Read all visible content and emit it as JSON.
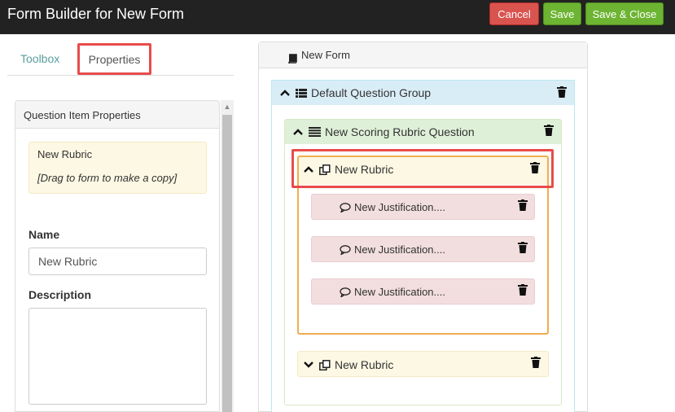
{
  "header": {
    "title": "Form Builder for New Form",
    "cancel_label": "Cancel",
    "save_label": "Save",
    "save_close_label": "Save & Close"
  },
  "tabs": {
    "toolbox": "Toolbox",
    "properties": "Properties"
  },
  "properties_panel": {
    "heading": "Question Item Properties",
    "item_name": "New Rubric",
    "item_hint": "[Drag to form to make a copy]",
    "name_label": "Name",
    "name_value": "New Rubric",
    "description_label": "Description",
    "description_value": ""
  },
  "form": {
    "title": "New Form",
    "group_title": "Default Question Group",
    "scoring_title": "New Scoring Rubric Question",
    "rubric_selected": "New Rubric",
    "justifications": [
      "New Justification....",
      "New Justification....",
      "New Justification...."
    ],
    "rubric_collapsed": "New Rubric"
  },
  "colors": {
    "header_bg": "#222222",
    "cancel": "#d9534f",
    "save": "#6cb431",
    "highlight": "#e94b4b"
  },
  "icons": [
    "book-icon",
    "list-icon",
    "scoring-list-icon",
    "copy-icon",
    "comment-icon",
    "trash-icon",
    "chevron-up-icon",
    "chevron-down-icon"
  ]
}
